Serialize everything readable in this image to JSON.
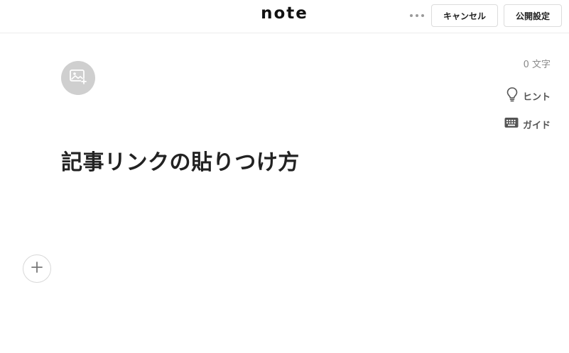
{
  "header": {
    "logo": "note",
    "more_icon": "more-horizontal-icon",
    "cancel_label": "キャンセル",
    "publish_label": "公開設定"
  },
  "editor": {
    "image_icon": "image-add-icon",
    "char_count": "0 文字",
    "hint_label": "ヒント",
    "hint_icon": "lightbulb-icon",
    "guide_label": "ガイド",
    "guide_icon": "keyboard-icon",
    "title": "記事リンクの貼りつけ方",
    "add_icon": "plus-icon"
  },
  "colors": {
    "text": "#222222",
    "muted": "#8a8a8a",
    "placeholder_bg": "#cfcfcf",
    "border": "#dcdcdc"
  }
}
